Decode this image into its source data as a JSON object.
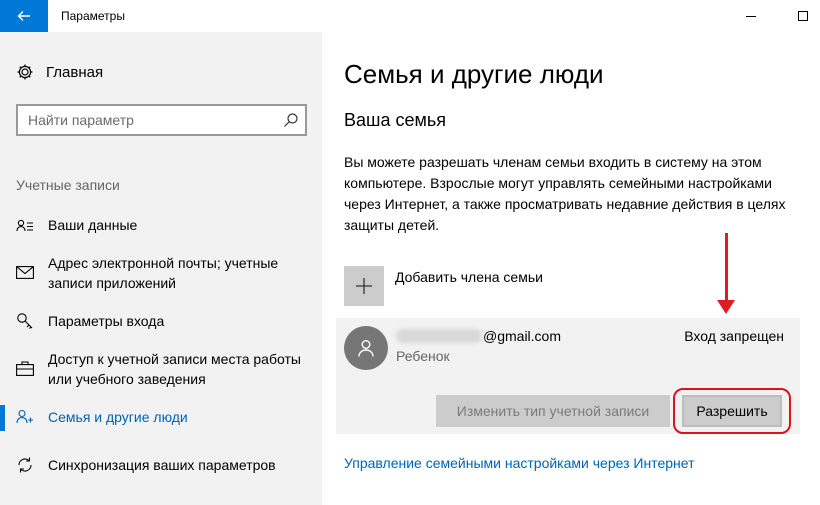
{
  "window": {
    "title": "Параметры"
  },
  "sidebar": {
    "home_label": "Главная",
    "search_placeholder": "Найти параметр",
    "section_label": "Учетные записи",
    "items": [
      {
        "label": "Ваши данные",
        "icon": "person-card-icon"
      },
      {
        "label": "Адрес электронной почты; учетные записи приложений",
        "icon": "mail-icon"
      },
      {
        "label": "Параметры входа",
        "icon": "key-icon"
      },
      {
        "label": "Доступ к учетной записи места работы или учебного заведения",
        "icon": "briefcase-icon"
      },
      {
        "label": "Семья и другие люди",
        "icon": "people-icon",
        "active": true
      },
      {
        "label": "Синхронизация ваших параметров",
        "icon": "sync-icon"
      }
    ]
  },
  "main": {
    "title": "Семья и другие люди",
    "subtitle": "Ваша семья",
    "description": "Вы можете разрешать членам семьи входить в систему на этом компьютере. Взрослые могут управлять семейными настройками через Интернет, а также просматривать недавние действия в целях защиты детей.",
    "add_member_label": "Добавить члена семьи",
    "member": {
      "email_suffix": "@gmail.com",
      "role": "Ребенок",
      "status": "Вход запрещен",
      "change_type_label": "Изменить тип учетной записи",
      "allow_label": "Разрешить"
    },
    "manage_link": "Управление семейными настройками через Интернет"
  },
  "colors": {
    "accent": "#0078d7",
    "link": "#0063b1",
    "annotation": "#e01b22"
  }
}
